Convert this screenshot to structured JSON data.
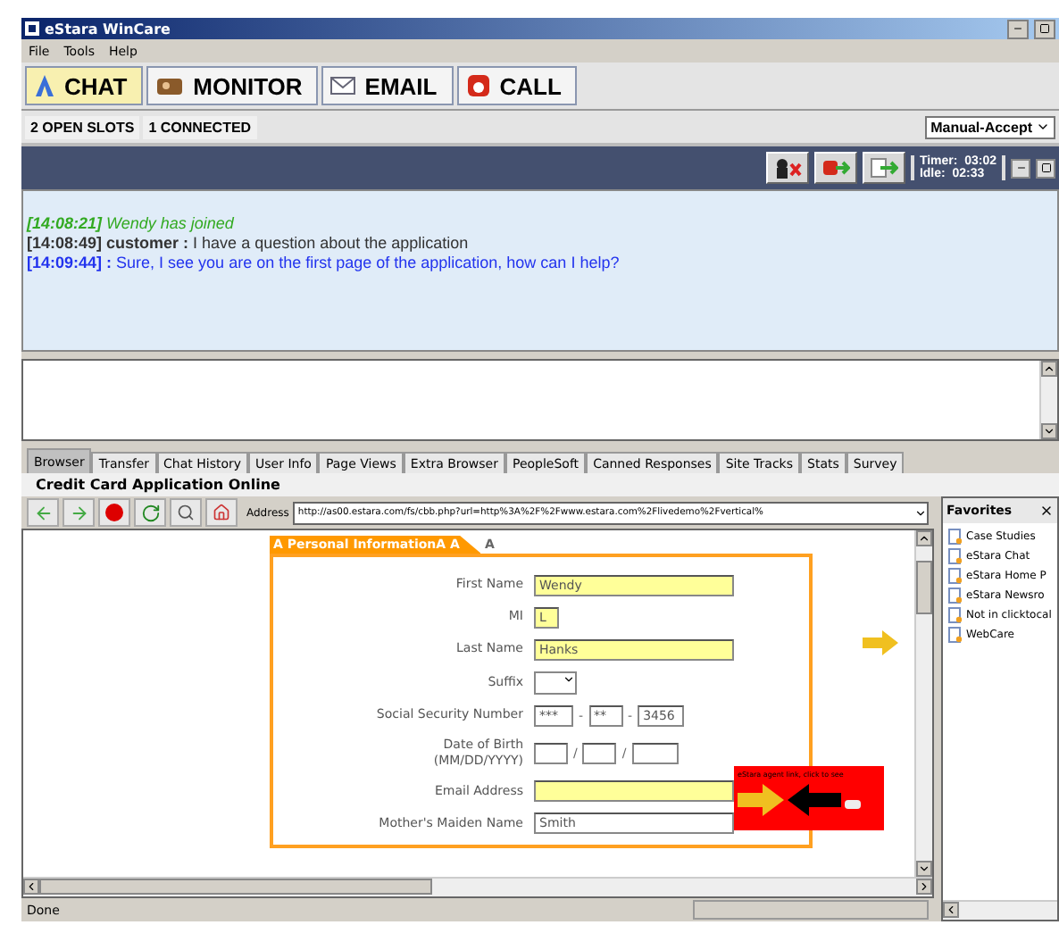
{
  "window": {
    "title": "eStara WinCare"
  },
  "menu": [
    "File",
    "Tools",
    "Help"
  ],
  "modes": [
    {
      "label": "CHAT",
      "kind": "chat",
      "selected": true
    },
    {
      "label": "MONITOR",
      "kind": "monitor",
      "selected": false
    },
    {
      "label": "EMAIL",
      "kind": "email",
      "selected": false
    },
    {
      "label": "CALL",
      "kind": "call",
      "selected": false
    }
  ],
  "slots": [
    "2 OPEN SLOTS",
    "1 CONNECTED"
  ],
  "accept_mode": "Manual-Accept",
  "timers": [
    {
      "label": "Timer:",
      "value": "03:02"
    },
    {
      "label": "Idle:",
      "value": "02:33"
    }
  ],
  "chat": [
    {
      "kind": "system",
      "time": "[14:08:21]",
      "text": "Wendy has joined"
    },
    {
      "kind": "customer",
      "time": "[14:08:49]",
      "sender": "customer :",
      "text": "I have a question about the application"
    },
    {
      "kind": "agent",
      "time": "[14:09:44]",
      "sender": ":",
      "text": "Sure,  I see you are on the first page of the application, how can I help?"
    }
  ],
  "tabs": [
    {
      "label": "Browser",
      "selected": true
    },
    {
      "label": "Transfer",
      "selected": false
    },
    {
      "label": "Chat History",
      "selected": false
    },
    {
      "label": "User Info",
      "selected": false
    },
    {
      "label": "Page Views",
      "selected": false
    },
    {
      "label": "Extra Browser",
      "selected": false
    },
    {
      "label": "PeopleSoft",
      "selected": false
    },
    {
      "label": "Canned Responses",
      "selected": false
    },
    {
      "label": "Site Tracks",
      "selected": false
    },
    {
      "label": "Stats",
      "selected": false
    },
    {
      "label": "Survey",
      "selected": false
    }
  ],
  "browser": {
    "title": "Credit Card Application Online",
    "address_label": "Address",
    "address": "http://as00.estara.com/fs/cbb.php?url=http%3A%2F%2Fwww.estara.com%2Flivedemo%2Fvertical%",
    "section_tabs": [
      {
        "label": "A Personal InformationA A",
        "selected": true
      },
      {
        "label": "A",
        "selected": false
      }
    ],
    "fields": [
      {
        "label": "First Name",
        "kind": "text",
        "value": "Wendy",
        "highlighted": true
      },
      {
        "label": "MI",
        "kind": "short",
        "value": "L",
        "highlighted": true
      },
      {
        "label": "Last Name",
        "kind": "text",
        "value": "Hanks",
        "highlighted": true
      },
      {
        "label": "Suffix",
        "kind": "select"
      },
      {
        "label": "Social Security Number",
        "kind": "ssn",
        "separator": "-",
        "values": [
          "***",
          "**",
          "3456"
        ]
      },
      {
        "label": "Date of Birth",
        "sublabel": "(MM/DD/YYYY)",
        "kind": "date",
        "separator": "/"
      },
      {
        "label": "Email Address",
        "kind": "text",
        "highlighted": true
      },
      {
        "label": "Mother's Maiden Name",
        "kind": "text",
        "value": "Smith",
        "highlighted": false
      }
    ],
    "hint": "eStara agent link, click to see"
  },
  "favorites": {
    "title": "Favorites",
    "items": [
      "Case Studies",
      "eStara Chat",
      "eStara Home P",
      "eStara Newsro",
      "Not in clicktocal",
      "WebCare"
    ]
  },
  "status_bar": "Done"
}
